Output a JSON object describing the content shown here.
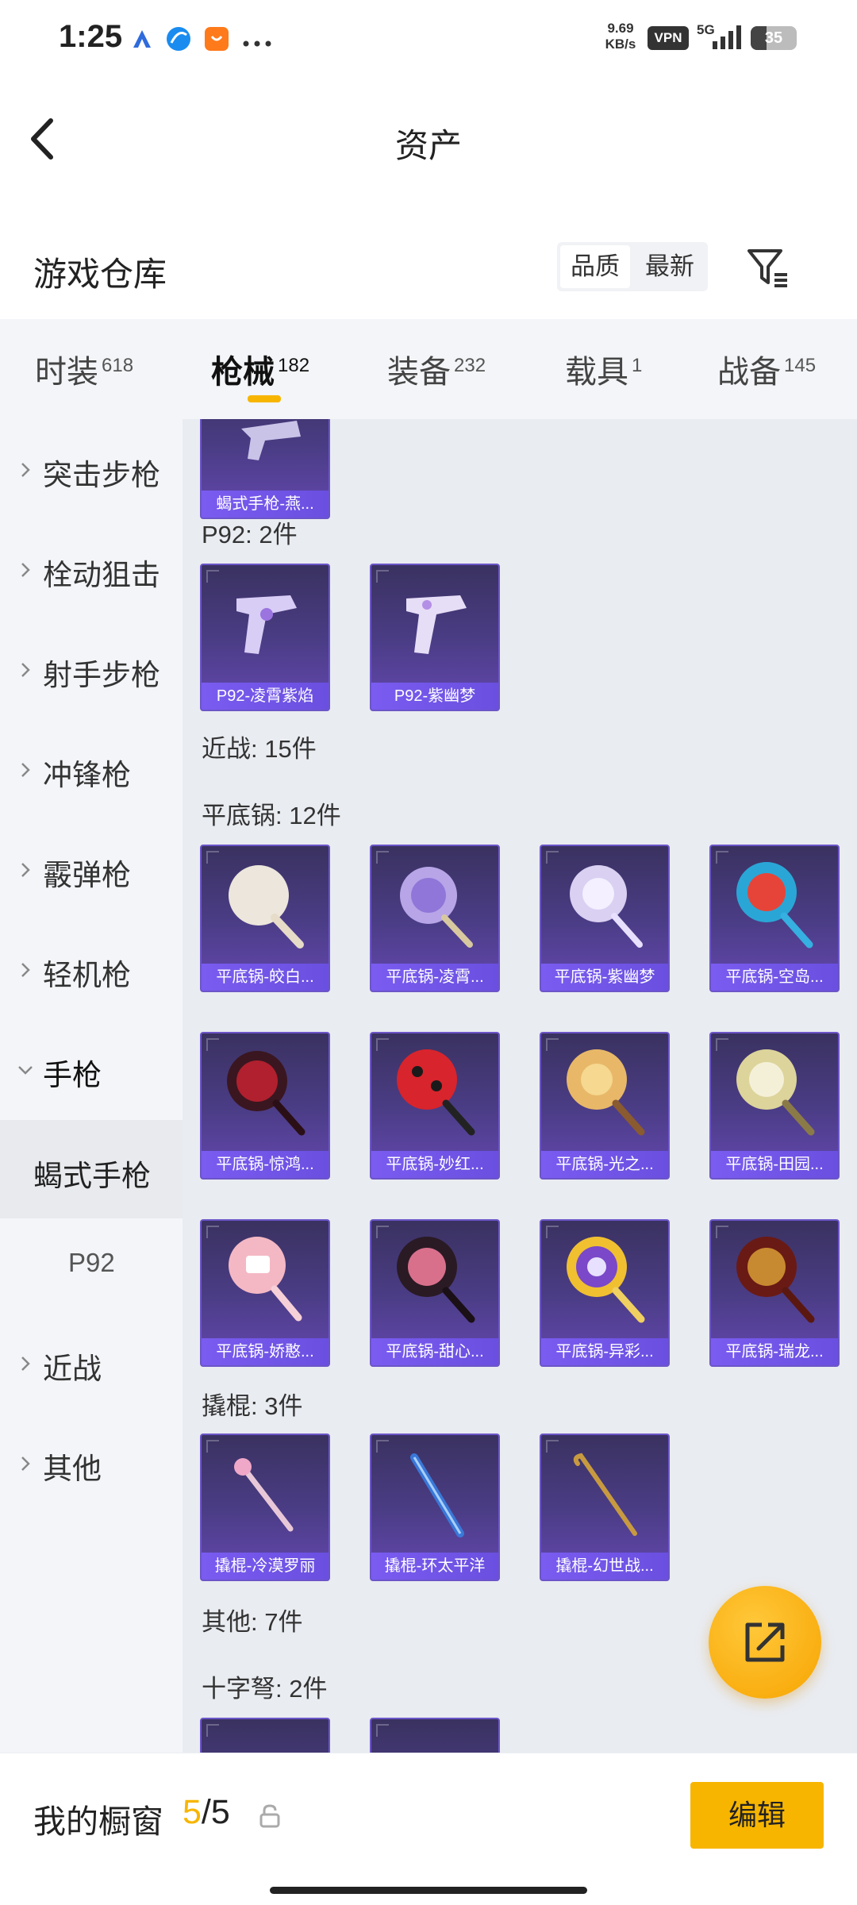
{
  "status_bar": {
    "time": "1:25",
    "net_speed_value": "9.69",
    "net_speed_unit": "KB/s",
    "vpn": "VPN",
    "network": "5G",
    "battery": "35"
  },
  "header": {
    "title": "资产",
    "back_icon": "chevron-left-icon"
  },
  "warehouse": {
    "title": "游戏仓库",
    "sort_options": [
      "品质",
      "最新"
    ],
    "selected_sort": "品质",
    "filter_icon": "filter-icon"
  },
  "tabs": [
    {
      "label": "时装",
      "count": "618",
      "active": false
    },
    {
      "label": "枪械",
      "count": "182",
      "active": true
    },
    {
      "label": "装备",
      "count": "232",
      "active": false
    },
    {
      "label": "载具",
      "count": "1",
      "active": false
    },
    {
      "label": "战备",
      "count": "145",
      "active": false
    }
  ],
  "sidebar": {
    "items": [
      {
        "label": "突击步枪",
        "state": "collapsed"
      },
      {
        "label": "栓动狙击",
        "state": "collapsed"
      },
      {
        "label": "射手步枪",
        "state": "collapsed"
      },
      {
        "label": "冲锋枪",
        "state": "collapsed"
      },
      {
        "label": "霰弹枪",
        "state": "collapsed"
      },
      {
        "label": "轻机枪",
        "state": "collapsed"
      },
      {
        "label": "手枪",
        "state": "expanded"
      },
      {
        "label": "蝎式手枪",
        "state": "selected-sub"
      },
      {
        "label": "P92",
        "state": "sub"
      },
      {
        "label": "近战",
        "state": "collapsed"
      },
      {
        "label": "其他",
        "state": "collapsed"
      }
    ]
  },
  "content": {
    "sections": {
      "p92": "P92: 2件",
      "melee": "近战: 15件",
      "pan": "平底锅: 12件",
      "crowbar": "撬棍: 3件",
      "other": "其他: 7件",
      "crossbow": "十字弩: 2件"
    },
    "items": {
      "scorpion": [
        "蝎式手枪-燕..."
      ],
      "p92": [
        "P92-凌霄紫焰",
        "P92-紫幽梦"
      ],
      "pan": [
        "平底锅-皎白...",
        "平底锅-凌霄...",
        "平底锅-紫幽梦",
        "平底锅-空岛...",
        "平底锅-惊鸿...",
        "平底锅-妙红...",
        "平底锅-光之...",
        "平底锅-田园...",
        "平底锅-娇憨...",
        "平底锅-甜心...",
        "平底锅-异彩...",
        "平底锅-瑞龙..."
      ],
      "crowbar": [
        "撬棍-冷漠罗丽",
        "撬棍-环太平洋",
        "撬棍-幻世战..."
      ]
    }
  },
  "fab": {
    "icon": "share-external-icon"
  },
  "bottom_bar": {
    "label": "我的橱窗",
    "current": "5",
    "separator": "/",
    "total": "5",
    "lock_icon": "lock-icon",
    "edit": "编辑"
  },
  "colors": {
    "accent": "#f7b500",
    "card_purple": "#4a3c84",
    "card_label": "#6a4fe0",
    "panel_bg": "#f3f5f8",
    "content_bg": "#e9ecf1"
  }
}
